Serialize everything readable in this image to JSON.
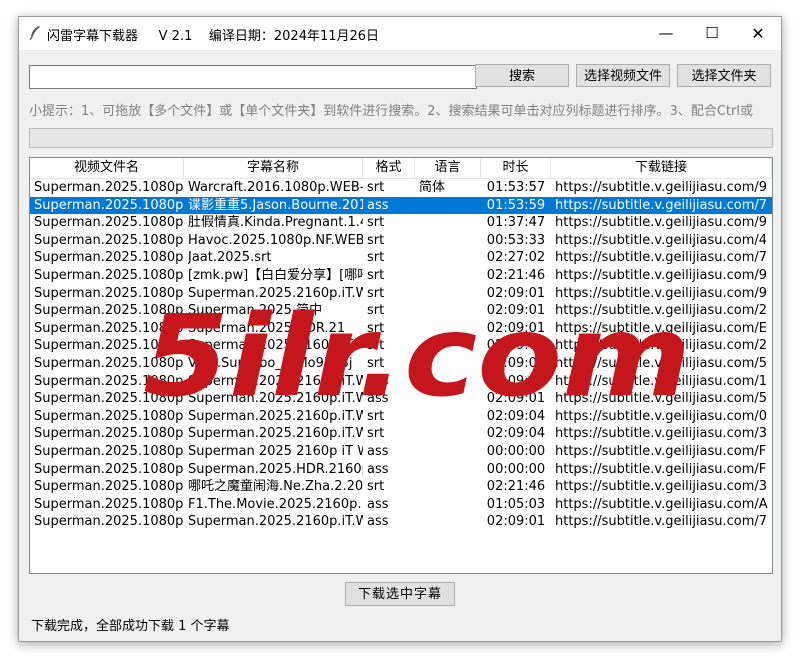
{
  "titlebar": {
    "title": "闪雷字幕下载器     V 2.1    编译日期：2024年11月26日",
    "minimize_glyph": "—",
    "maximize_glyph": "☐",
    "close_glyph": "✕"
  },
  "search": {
    "value": "",
    "placeholder": ""
  },
  "buttons": {
    "search": "搜索",
    "select_video": "选择视频文件",
    "select_folder": "选择文件夹",
    "download": "下载选中字幕"
  },
  "tip": "小提示：1、可拖放【多个文件】或【单个文件夹】到软件进行搜索。2、搜索结果可单击对应列标题进行排序。3、配合Ctrl或",
  "progress": {
    "fraction": 0
  },
  "table": {
    "columns": [
      "视频文件名",
      "字幕名称",
      "格式",
      "语言",
      "时长",
      "下载链接"
    ],
    "rows": [
      [
        "Superman.2025.1080p",
        "Warcraft.2016.1080p.WEB-",
        "srt",
        "简体",
        "01:53:57",
        "https://subtitle.v.geilijiasu.com/9"
      ],
      [
        "Superman.2025.1080p",
        "谍影重重5.Jason.Bourne.201",
        "ass",
        "",
        "01:53:59",
        "https://subtitle.v.geilijiasu.com/7"
      ],
      [
        "Superman.2025.1080p",
        "肚假情真.Kinda.Pregnant.1.4",
        "srt",
        "",
        "01:37:47",
        "https://subtitle.v.geilijiasu.com/9"
      ],
      [
        "Superman.2025.1080p",
        "Havoc.2025.1080p.NF.WEB",
        "srt",
        "",
        "00:53:33",
        "https://subtitle.v.geilijiasu.com/4"
      ],
      [
        "Superman.2025.1080p",
        "Jaat.2025.srt",
        "srt",
        "",
        "02:27:02",
        "https://subtitle.v.geilijiasu.com/7"
      ],
      [
        "Superman.2025.1080p",
        "[zmk.pw]【白白爱分享】[哪吒",
        "srt",
        "",
        "02:21:46",
        "https://subtitle.v.geilijiasu.com/9"
      ],
      [
        "Superman.2025.1080p",
        "Superman.2025.2160p.iT.W",
        "srt",
        "",
        "02:09:01",
        "https://subtitle.v.geilijiasu.com/9"
      ],
      [
        "Superman.2025.1080p",
        "Superman.2025.简中",
        "srt",
        "",
        "02:09:01",
        "https://subtitle.v.geilijiasu.com/2"
      ],
      [
        "Superman.2025.1080p",
        "Superman.2025.HDR.21",
        "srt",
        "",
        "02:09:01",
        "https://subtitle.v.geilijiasu.com/E"
      ],
      [
        "Superman.2025.1080p",
        "Superman.2025.2160p.iT",
        "srt",
        "",
        "02:09:01",
        "https://subtitle.v.geilijiasu.com/2"
      ],
      [
        "Superman.2025.1080p",
        "VOD.Superbo_UtMo9Kd3j",
        "srt",
        "",
        "02:09:01",
        "https://subtitle.v.geilijiasu.com/5"
      ],
      [
        "Superman.2025.1080p",
        "Superman.2025.2160p.iT.W",
        "ass",
        "",
        "02:09:01",
        "https://subtitle.v.geilijiasu.com/1"
      ],
      [
        "Superman.2025.1080p",
        "Superman.2025.2160p.iT.W",
        "ass",
        "",
        "02:09:01",
        "https://subtitle.v.geilijiasu.com/5"
      ],
      [
        "Superman.2025.1080p",
        "Superman.2025.2160p.iT.W",
        "srt",
        "",
        "02:09:04",
        "https://subtitle.v.geilijiasu.com/0"
      ],
      [
        "Superman.2025.1080p",
        "Superman.2025.2160p.iT.W",
        "srt",
        "",
        "02:09:04",
        "https://subtitle.v.geilijiasu.com/3"
      ],
      [
        "Superman.2025.1080p",
        "Superman 2025 2160p iT W",
        "ass",
        "",
        "00:00:00",
        "https://subtitle.v.geilijiasu.com/F"
      ],
      [
        "Superman.2025.1080p",
        "Superman.2025.HDR.2160p",
        "ass",
        "",
        "00:00:00",
        "https://subtitle.v.geilijiasu.com/F"
      ],
      [
        "Superman.2025.1080p",
        "哪吒之魔童闹海.Ne.Zha.2.20",
        "srt",
        "",
        "02:21:46",
        "https://subtitle.v.geilijiasu.com/3"
      ],
      [
        "Superman.2025.1080p",
        "F1.The.Movie.2025.2160p.",
        "ass",
        "",
        "01:05:03",
        "https://subtitle.v.geilijiasu.com/A"
      ],
      [
        "Superman.2025.1080p",
        "Superman.2025.2160p.iT.W",
        "ass",
        "",
        "02:09:01",
        "https://subtitle.v.geilijiasu.com/7"
      ]
    ],
    "selected_row": 1
  },
  "watermark": "5ilr.com",
  "status": "下载完成，全部成功下载 1 个字幕"
}
